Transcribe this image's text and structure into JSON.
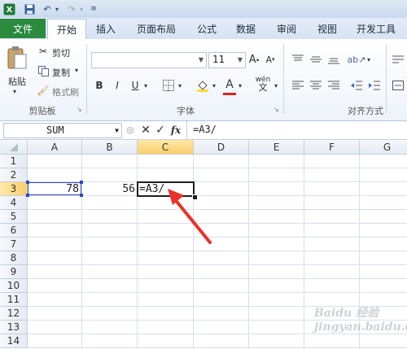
{
  "quick_access": {
    "save_icon": "save-icon",
    "undo_icon": "undo-icon",
    "redo_icon": "redo-icon"
  },
  "tabs": [
    "文件",
    "开始",
    "插入",
    "页面布局",
    "公式",
    "数据",
    "审阅",
    "视图",
    "开发工具"
  ],
  "active_tab": "开始",
  "clipboard": {
    "paste": "粘贴",
    "cut": "剪切",
    "copy": "复制",
    "format_painter": "格式刷",
    "group": "剪贴板"
  },
  "font": {
    "size": "11",
    "bold": "B",
    "italic": "I",
    "underline": "U",
    "font_color": "A",
    "phonetic": "wén",
    "group": "字体"
  },
  "alignment": {
    "group": "对齐方式"
  },
  "formula_bar": {
    "name_box": "SUM",
    "fx": "fx",
    "formula": "=A3/"
  },
  "columns": [
    "A",
    "B",
    "C",
    "D",
    "E",
    "F",
    "G"
  ],
  "selected_column": "C",
  "rows": [
    "1",
    "2",
    "3",
    "4",
    "5",
    "6",
    "7",
    "8",
    "9",
    "10",
    "11",
    "12",
    "13",
    "14"
  ],
  "selected_row": "3",
  "cells": {
    "A3": "78",
    "B3": "56",
    "C3": "=A3/"
  },
  "watermark": "Baidu 经验 jingyan.baidu.com",
  "colors": {
    "accent_green": "#2a8a3e",
    "selection": "#1e1e1e",
    "reference_border": "#2f44c8",
    "arrow": "#e8322a"
  }
}
